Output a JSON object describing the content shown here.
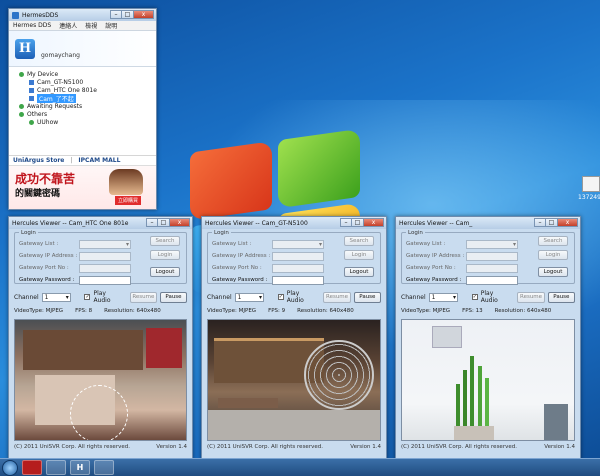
{
  "desktop": {
    "icon_label": "137249"
  },
  "hermes": {
    "title": "HermesDDS",
    "menu": [
      "Hermes DDS",
      "連絡人",
      "檢視",
      "說明"
    ],
    "logo": "H",
    "username": "gomaychang",
    "tree": [
      {
        "label": "My Device",
        "level": 1,
        "kind": "group"
      },
      {
        "label": "Cam_GT-N5100",
        "level": 2,
        "kind": "device"
      },
      {
        "label": "Cam_HTC One 801e",
        "level": 2,
        "kind": "device"
      },
      {
        "label": "Cam_了不起",
        "level": 2,
        "kind": "device",
        "selected": true
      },
      {
        "label": "Awaiting Requests",
        "level": 1,
        "kind": "group"
      },
      {
        "label": "Others",
        "level": 1,
        "kind": "group"
      },
      {
        "label": "UUhow",
        "level": 2,
        "kind": "person"
      }
    ],
    "store_text": "UniArgus Store",
    "store_sep": "|",
    "store_mall": "IPCAM MALL",
    "ad_title": "成功不靠苦",
    "ad_sub": "的關鍵密碼",
    "ad_button": "立即購買"
  },
  "viewers": [
    {
      "title": "Hercules Viewer -- Cam_HTC One 801e",
      "login_legend": "Login",
      "fields": [
        "Gateway List :",
        "Gateway IP Address :",
        "Gateway Port No :",
        "Gateway Password :"
      ],
      "btn_search": "Search",
      "btn_login": "Login",
      "btn_logout": "Logout",
      "channel_label": "Channel",
      "channel_value": "1",
      "play_audio": "Play Audio",
      "btn_resume": "Resume",
      "btn_pause": "Pause",
      "videotype": "VideoType: MJPEG",
      "fps": "FPS: 8",
      "resolution": "Resolution: 640x480",
      "copyright": "(C) 2011 UniSVR Corp. All rights reserved.",
      "version": "Version 1.4"
    },
    {
      "title": "Hercules Viewer -- Cam_GT-N5100",
      "login_legend": "Login",
      "fields": [
        "Gateway List :",
        "Gateway IP Address :",
        "Gateway Port No :",
        "Gateway Password :"
      ],
      "btn_search": "Search",
      "btn_login": "Login",
      "btn_logout": "Logout",
      "channel_label": "Channel",
      "channel_value": "1",
      "play_audio": "Play Audio",
      "btn_resume": "Resume",
      "btn_pause": "Pause",
      "videotype": "VideoType: MJPEG",
      "fps": "FPS: 9",
      "resolution": "Resolution: 640x480",
      "copyright": "(C) 2011 UniSVR Corp. All rights reserved.",
      "version": "Version 1.4"
    },
    {
      "title": "Hercules Viewer -- Cam_",
      "login_legend": "Login",
      "fields": [
        "Gateway List :",
        "Gateway IP Address :",
        "Gateway Port No :",
        "Gateway Password :"
      ],
      "btn_search": "Search",
      "btn_login": "Login",
      "btn_logout": "Logout",
      "channel_label": "Channel",
      "channel_value": "1",
      "play_audio": "Play Audio",
      "btn_resume": "Resume",
      "btn_pause": "Pause",
      "videotype": "VideoType: MJPEG",
      "fps": "FPS: 13",
      "resolution": "Resolution: 640x480",
      "copyright": "(C) 2011 UniSVR Corp. All rights reserved.",
      "version": "Version 1.4"
    }
  ],
  "window_buttons": {
    "minimize": "–",
    "maximize": "□",
    "close": "x"
  },
  "checkmark": "✓",
  "taskbar": [
    "H"
  ]
}
